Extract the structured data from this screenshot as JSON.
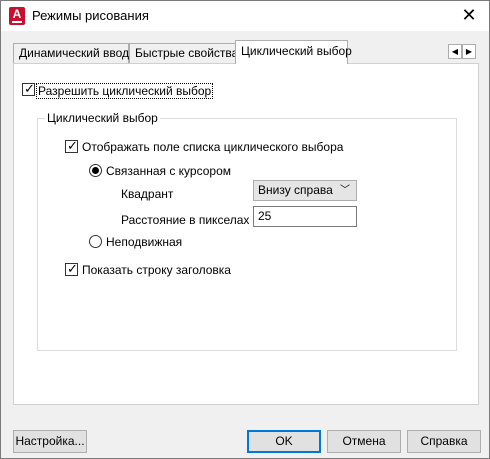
{
  "window": {
    "title": "Режимы рисования",
    "app_icon_letter": "A"
  },
  "tabs": [
    {
      "label": "Динамический ввод",
      "active": false
    },
    {
      "label": "Быстрые свойства",
      "active": false
    },
    {
      "label": "Циклический выбор",
      "active": true
    }
  ],
  "tab_scroll": {
    "left": "◀",
    "right": "▶"
  },
  "panel": {
    "enable_label": "Разрешить циклический выбор",
    "enable_checked": true,
    "group_title": "Циклический выбор",
    "show_list_label": "Отображать поле списка циклического выбора",
    "show_list_checked": true,
    "cursor_radio_label": "Связанная с курсором",
    "cursor_radio_selected": true,
    "quadrant_label": "Квадрант",
    "quadrant_value": "Внизу справа",
    "distance_label": "Расстояние в пикселах",
    "distance_value": "25",
    "static_radio_label": "Неподвижная",
    "static_radio_selected": false,
    "show_title_label": "Показать строку заголовка",
    "show_title_checked": true
  },
  "buttons": {
    "settings": "Настройка...",
    "ok": "OK",
    "cancel": "Отмена",
    "help": "Справка"
  }
}
